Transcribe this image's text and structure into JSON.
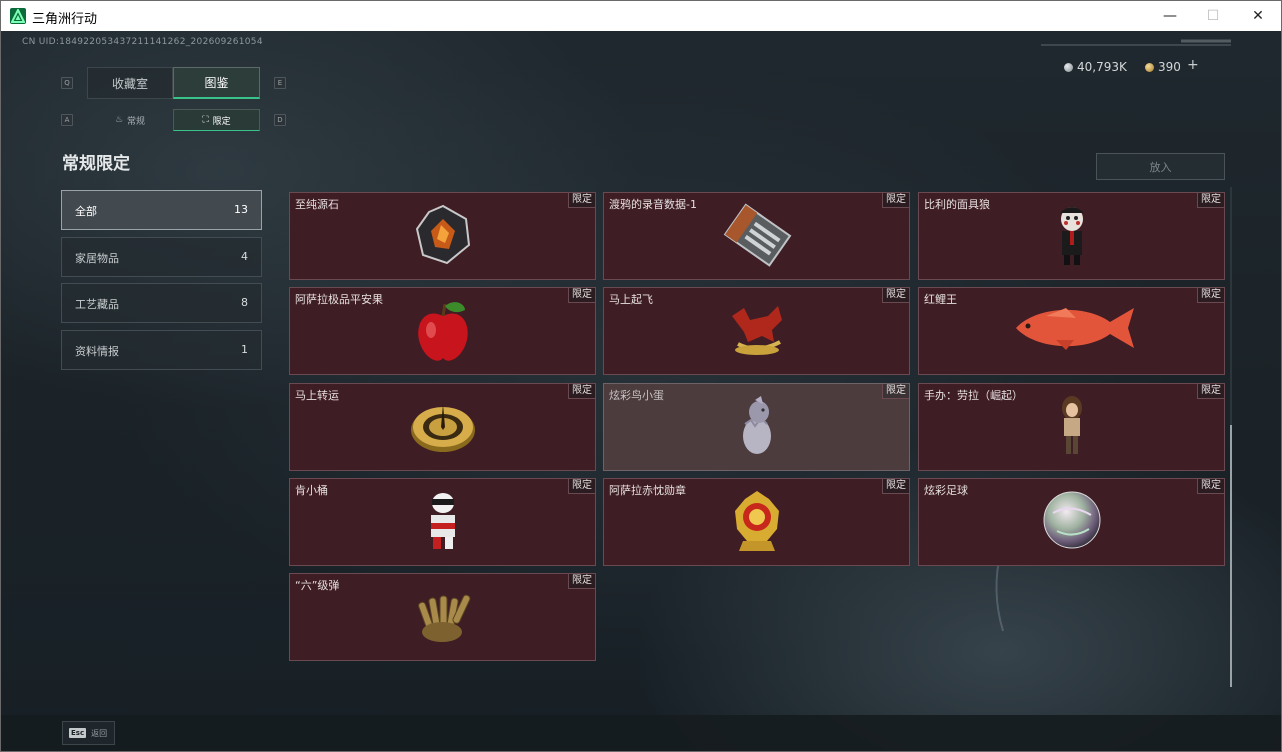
{
  "window": {
    "title": "三角洲行动",
    "minimize": "—",
    "maximize": "☐",
    "close": "✕"
  },
  "uid": "CN UID:18492205343721114126​2_202609261054",
  "currency": {
    "silver": "40,793K",
    "gold": "390",
    "plus": "+"
  },
  "tabs": {
    "q_key": "Q",
    "e_key": "E",
    "a_key": "A",
    "d_key": "D",
    "main": [
      {
        "label": "收藏室"
      },
      {
        "label": "图鉴"
      }
    ],
    "sub": [
      {
        "label": "常规"
      },
      {
        "label": "限定"
      }
    ]
  },
  "section_title": "常规限定",
  "categories": [
    {
      "label": "全部",
      "count": "13"
    },
    {
      "label": "家居物品",
      "count": "4"
    },
    {
      "label": "工艺藏品",
      "count": "8"
    },
    {
      "label": "资料情报",
      "count": "1"
    }
  ],
  "put_button": "放入",
  "tag_label": "限定",
  "items": [
    {
      "name": "至纯源石",
      "icon": "gem-icon"
    },
    {
      "name": "渡鸦的录音数据-1",
      "icon": "tape-icon"
    },
    {
      "name": "比利的面具狼",
      "icon": "puppet-icon"
    },
    {
      "name": "阿萨拉极品平安果",
      "icon": "apple-icon"
    },
    {
      "name": "马上起飞",
      "icon": "horse-icon"
    },
    {
      "name": "红鲤王",
      "icon": "carp-icon"
    },
    {
      "name": "马上转运",
      "icon": "compass-icon"
    },
    {
      "name": "炫彩鸟小蛋",
      "icon": "egg-icon"
    },
    {
      "name": "手办：劳拉（崛起）",
      "icon": "figure-icon"
    },
    {
      "name": "肯小桶",
      "icon": "robot-icon"
    },
    {
      "name": "阿萨拉赤忱勋章",
      "icon": "medal-icon"
    },
    {
      "name": "炫彩足球",
      "icon": "ball-icon"
    },
    {
      "name": "“六”级弹",
      "icon": "bullet-icon"
    }
  ],
  "footer": {
    "esc_key": "Esc",
    "esc_label": "返回"
  },
  "colors": {
    "card_bg": "#3f1d24",
    "accent_green": "#39c28a",
    "active_tab": "#2c3d3a"
  }
}
